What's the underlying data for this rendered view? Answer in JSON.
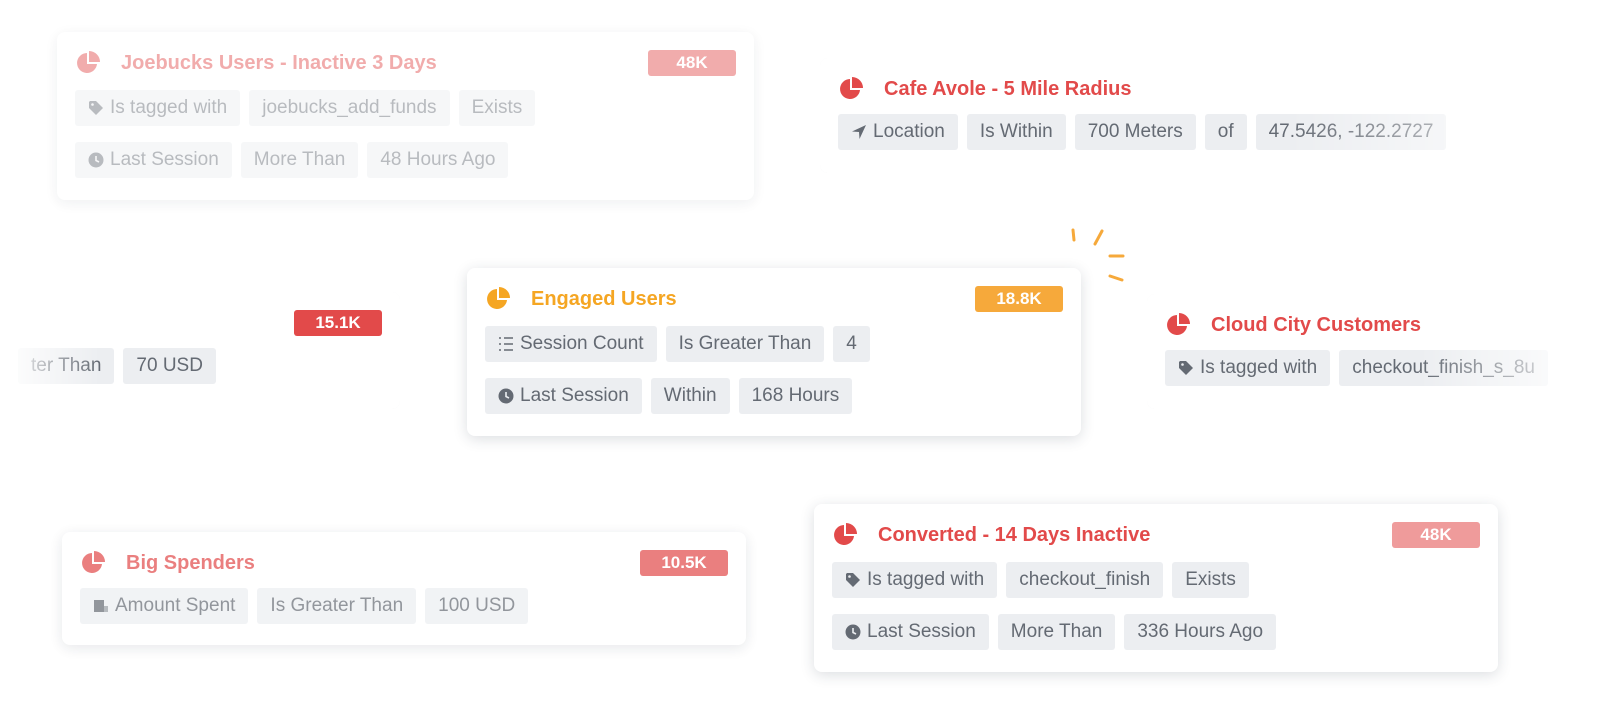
{
  "colors": {
    "red": "#e24a4a",
    "orange": "#f6a93b",
    "chip_bg": "#eceef1",
    "chip_text": "#646a73"
  },
  "cards": {
    "joebucks": {
      "title": "Joebucks Users - Inactive 3 Days",
      "count": "48K",
      "rows": [
        [
          "Is tagged with",
          "joebucks_add_funds",
          "Exists"
        ],
        [
          "Last Session",
          "More Than",
          "48 Hours Ago"
        ]
      ],
      "icons": [
        "tag-icon",
        "clock-icon"
      ]
    },
    "cafe": {
      "title": "Cafe Avole - 5 Mile Radius",
      "rows": [
        [
          "Location",
          "Is Within",
          "700 Meters",
          "of",
          "47.5426, -122.2727"
        ]
      ],
      "icons": [
        "location-arrow-icon"
      ]
    },
    "partial": {
      "count": "15.1K",
      "rows": [
        [
          "ter Than",
          "70 USD"
        ]
      ]
    },
    "engaged": {
      "title": "Engaged Users",
      "count": "18.8K",
      "rows": [
        [
          "Session Count",
          "Is Greater Than",
          "4"
        ],
        [
          "Last Session",
          "Within",
          "168 Hours"
        ]
      ],
      "icons": [
        "list-icon",
        "clock-icon"
      ]
    },
    "cloud": {
      "title": "Cloud City Customers",
      "rows": [
        [
          "Is tagged with",
          "checkout_finish_s_8u"
        ]
      ],
      "icons": [
        "tag-icon"
      ]
    },
    "big": {
      "title": "Big Spenders",
      "count": "10.5K",
      "rows": [
        [
          "Amount Spent",
          "Is Greater Than",
          "100 USD"
        ]
      ],
      "icons": [
        "money-icon"
      ]
    },
    "converted": {
      "title": "Converted - 14 Days Inactive",
      "count": "48K",
      "rows": [
        [
          "Is tagged with",
          "checkout_finish",
          "Exists"
        ],
        [
          "Last Session",
          "More Than",
          "336 Hours Ago"
        ]
      ],
      "icons": [
        "tag-icon",
        "clock-icon"
      ]
    }
  }
}
